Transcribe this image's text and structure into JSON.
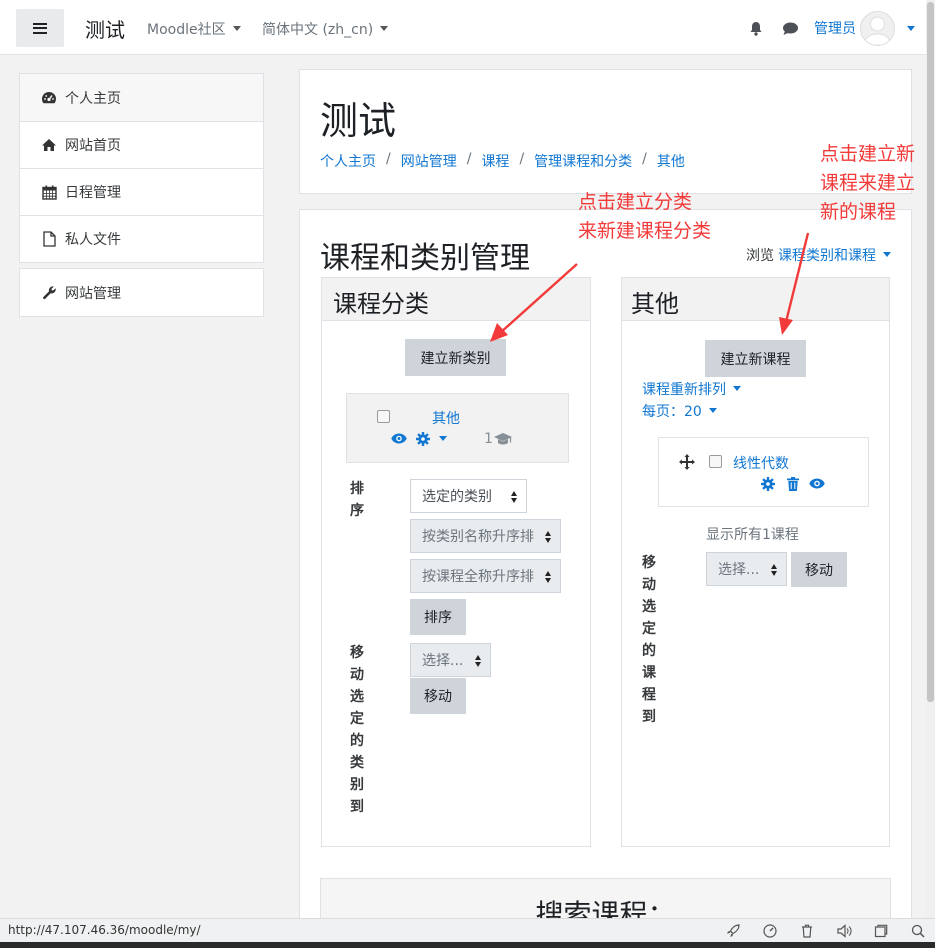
{
  "navbar": {
    "site_name": "测试",
    "menu_community": "Moodle社区",
    "menu_language": "简体中文 (zh_cn)",
    "user_name": "管理员"
  },
  "sidebar": {
    "items": [
      {
        "label": "个人主页",
        "icon": "dashboard-icon"
      },
      {
        "label": "网站首页",
        "icon": "home-icon"
      },
      {
        "label": "日程管理",
        "icon": "calendar-icon"
      },
      {
        "label": "私人文件",
        "icon": "file-icon"
      }
    ],
    "admin_item": {
      "label": "网站管理",
      "icon": "wrench-icon"
    }
  },
  "header": {
    "title": "测试",
    "breadcrumb": [
      "个人主页",
      "网站管理",
      "课程",
      "管理课程和分类",
      "其他"
    ]
  },
  "main": {
    "title": "课程和类别管理",
    "browse_label": "浏览",
    "browse_value": "课程类别和课程"
  },
  "categories_panel": {
    "title": "课程分类",
    "create_button": "建立新类别",
    "category_name": "其他",
    "course_count": "1",
    "sort_label": "排序",
    "sort_select": "选定的类别",
    "sort_by_name": "按类别名称升序排",
    "sort_by_fullname": "按课程全称升序排",
    "sort_button": "排序",
    "move_label": "移动选定的类别到",
    "move_select": "选择...",
    "move_button": "移动"
  },
  "courses_panel": {
    "title": "其他",
    "create_button": "建立新课程",
    "resort_label": "课程重新排列",
    "per_page_label": "每页：20",
    "course_name": "线性代数",
    "show_all": "显示所有1课程",
    "move_label": "移动选定的课程到",
    "move_select": "选择...",
    "move_button": "移动"
  },
  "search": {
    "title": "搜索课程："
  },
  "annotations": {
    "new_category": "点击建立分类\n来新建课程分类",
    "new_course": "点击建立新\n课程来建立\n新的课程",
    "color": "#f23a3a"
  },
  "statusbar": {
    "url": "http://47.107.46.36/moodle/my/"
  },
  "colors": {
    "link": "#1177d1",
    "button": "#ced4da",
    "panel_header": "#f2f2f2"
  }
}
